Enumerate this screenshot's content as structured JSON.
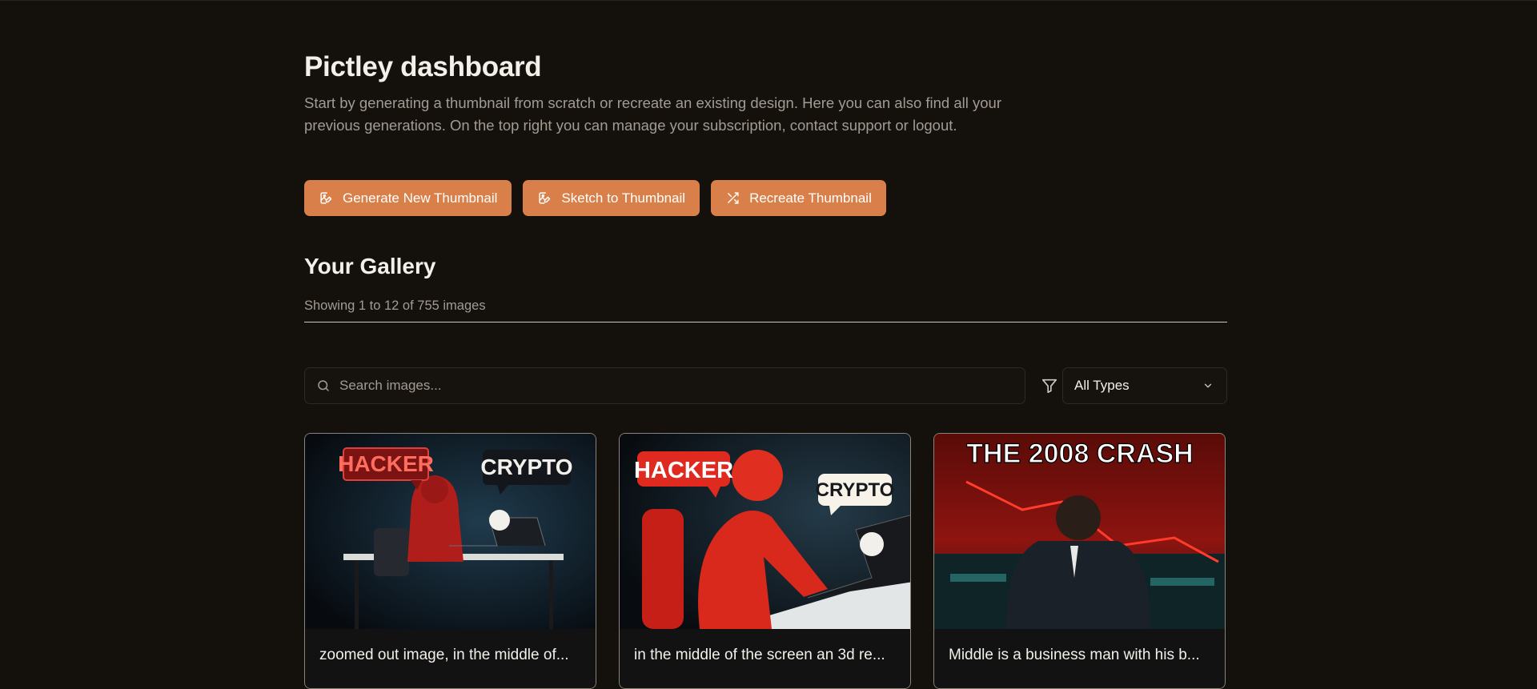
{
  "header": {
    "title": "Pictley dashboard",
    "description": "Start by generating a thumbnail from scratch or recreate an existing design. Here you can also find all your previous generations. On the top right you can manage your subscription, contact support or logout."
  },
  "actions": [
    {
      "label": "Generate New Thumbnail",
      "icon": "image-edit-icon"
    },
    {
      "label": "Sketch to Thumbnail",
      "icon": "image-edit-icon"
    },
    {
      "label": "Recreate Thumbnail",
      "icon": "shuffle-icon"
    }
  ],
  "gallery": {
    "title": "Your Gallery",
    "count_text": "Showing 1 to 12 of 755 images",
    "search_placeholder": "Search images...",
    "filter_selected": "All Types",
    "items": [
      {
        "caption": "zoomed out image, in the middle of...",
        "label_left": "HACKER",
        "label_right": "CRYPTO"
      },
      {
        "caption": "in the middle of the screen an 3d re...",
        "label_left": "HACKER",
        "label_right": "CRYPTO"
      },
      {
        "caption": "Middle is a business man with his b...",
        "headline": "THE 2008 CRASH"
      }
    ]
  },
  "colors": {
    "background": "#14100c",
    "accent": "#d9804a",
    "muted_text": "#a39b92"
  }
}
